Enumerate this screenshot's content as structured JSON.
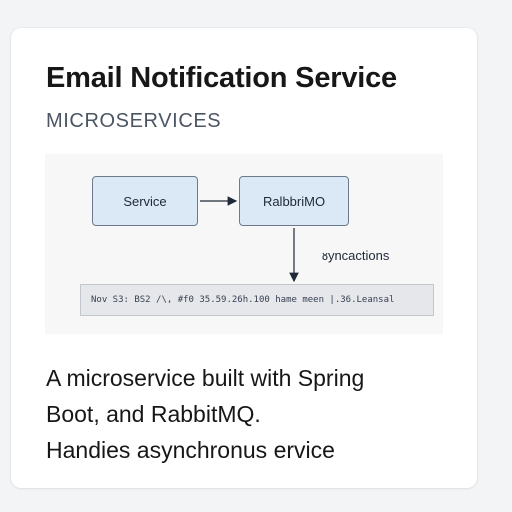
{
  "card": {
    "title": "Email Notification Service",
    "category": "MICROSERVICES",
    "description_lines": [
      "A microservice built with Spring",
      "Boot, and RabbitMQ.",
      "Handies asynchronus ervice"
    ]
  },
  "diagram": {
    "nodes": {
      "service": "Service",
      "queue": "RalbbriMO"
    },
    "edge_label": "ᴕyncactions",
    "log_line": "Nov S3: BS2 /\\, #f0 35.59.26h.100 hame meen |.36.Leansal"
  }
}
